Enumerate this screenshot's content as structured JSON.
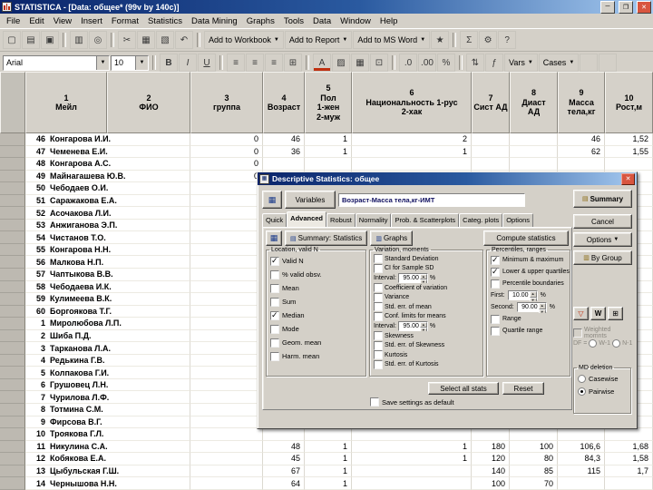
{
  "titlebar": {
    "title": "STATISTICA - [Data: общее* (99v by 140c)]"
  },
  "menu": {
    "items": [
      "File",
      "Edit",
      "View",
      "Insert",
      "Format",
      "Statistics",
      "Data Mining",
      "Graphs",
      "Tools",
      "Data",
      "Window",
      "Help"
    ]
  },
  "toolbar1": {
    "items": [
      {
        "type": "icon",
        "name": "new-file-icon",
        "glyph": "▢"
      },
      {
        "type": "icon",
        "name": "open-file-icon",
        "glyph": "▤"
      },
      {
        "type": "icon",
        "name": "save-icon",
        "glyph": "▣"
      },
      {
        "type": "sep"
      },
      {
        "type": "icon",
        "name": "print-icon",
        "glyph": "▥"
      },
      {
        "type": "icon",
        "name": "print-preview-icon",
        "glyph": "◎"
      },
      {
        "type": "sep"
      },
      {
        "type": "icon",
        "name": "cut-icon",
        "glyph": "✂"
      },
      {
        "type": "icon",
        "name": "copy-icon",
        "glyph": "▦"
      },
      {
        "type": "icon",
        "name": "paste-icon",
        "glyph": "▧"
      },
      {
        "type": "icon",
        "name": "undo-icon",
        "glyph": "↶"
      },
      {
        "type": "sep"
      },
      {
        "type": "dropbtn",
        "name": "add-to-workbook-button",
        "label": "Add to Workbook"
      },
      {
        "type": "dropbtn",
        "name": "add-to-report-button",
        "label": "Add to Report"
      },
      {
        "type": "dropbtn",
        "name": "add-to-ms-word-button",
        "label": "Add to MS Word"
      },
      {
        "type": "icon",
        "name": "wizard-icon",
        "glyph": "★"
      },
      {
        "type": "sep"
      },
      {
        "type": "icon",
        "name": "sum-icon",
        "glyph": "Σ"
      },
      {
        "type": "icon",
        "name": "settings-icon",
        "glyph": "⚙"
      },
      {
        "type": "icon",
        "name": "help-icon",
        "glyph": "?"
      }
    ]
  },
  "toolbar2": {
    "items": [
      {
        "type": "combo",
        "name": "font-family-combo",
        "value": "Arial",
        "w": 118
      },
      {
        "type": "combo",
        "name": "font-size-combo",
        "value": "10",
        "w": 42
      },
      {
        "type": "sep"
      },
      {
        "type": "icon",
        "name": "bold-icon",
        "glyph": "B",
        "cls": "b"
      },
      {
        "type": "icon",
        "name": "italic-icon",
        "glyph": "I",
        "cls": "i"
      },
      {
        "type": "icon",
        "name": "underline-icon",
        "glyph": "U",
        "cls": "u"
      },
      {
        "type": "sep"
      },
      {
        "type": "icon",
        "name": "align-left-icon",
        "glyph": "≡"
      },
      {
        "type": "icon",
        "name": "align-center-icon",
        "glyph": "≡"
      },
      {
        "type": "icon",
        "name": "align-right-icon",
        "glyph": "≡"
      },
      {
        "type": "icon",
        "name": "merge-cells-icon",
        "glyph": "⊞"
      },
      {
        "type": "sep"
      },
      {
        "type": "icon",
        "name": "font-color-icon",
        "glyph": "A",
        "cls": "red-underline"
      },
      {
        "type": "icon",
        "name": "fill-color-icon",
        "glyph": "▨"
      },
      {
        "type": "icon",
        "name": "borders-icon",
        "glyph": "▦"
      },
      {
        "type": "icon",
        "name": "grid-icon",
        "glyph": "⊡"
      },
      {
        "type": "sep"
      },
      {
        "type": "icon",
        "name": "increase-decimals-icon",
        "glyph": ".0"
      },
      {
        "type": "icon",
        "name": "decrease-decimals-icon",
        "glyph": ".00"
      },
      {
        "type": "icon",
        "name": "percent-icon",
        "glyph": "%"
      },
      {
        "type": "sep"
      },
      {
        "type": "icon",
        "name": "sort-icon",
        "glyph": "⇅"
      },
      {
        "type": "icon",
        "name": "function-icon",
        "glyph": "ƒ"
      },
      {
        "type": "dropbtn",
        "name": "vars-button",
        "label": "Vars"
      },
      {
        "type": "dropbtn",
        "name": "cases-button",
        "label": "Cases"
      },
      {
        "type": "icon",
        "name": "blank-tool-icon-1",
        "glyph": ""
      },
      {
        "type": "icon",
        "name": "blank-tool-icon-2",
        "glyph": ""
      }
    ]
  },
  "sheet": {
    "headers": [
      {
        "num": "1",
        "label": "Мейл"
      },
      {
        "num": "2",
        "label": "ФИО"
      },
      {
        "num": "3",
        "label": "группа"
      },
      {
        "num": "4",
        "label": "Возраст"
      },
      {
        "num": "5",
        "label": "Пол\n1-жен\n2-муж"
      },
      {
        "num": "6",
        "label": "Национальность 1-рус\n2-хак"
      },
      {
        "num": "7",
        "label": "Сист АД"
      },
      {
        "num": "8",
        "label": "Диаст\nАД"
      },
      {
        "num": "9",
        "label": "Масса\nтела,кг"
      },
      {
        "num": "10",
        "label": "Рост,м"
      }
    ],
    "rows": [
      {
        "n": "46",
        "name": "Конгарова И.И.",
        "c": [
          "0",
          "46",
          "1",
          "2",
          "",
          "",
          "46",
          "1,52"
        ]
      },
      {
        "n": "47",
        "name": "Чеменева Е.И.",
        "c": [
          "0",
          "36",
          "1",
          "1",
          "",
          "",
          "62",
          "1,55"
        ]
      },
      {
        "n": "48",
        "name": "Конгарова А.С.",
        "c": [
          "0",
          "",
          "",
          "",
          "",
          "",
          "",
          ""
        ]
      },
      {
        "n": "49",
        "name": "Майнагашева Ю.В.",
        "c": [
          "0",
          "",
          "",
          "",
          "",
          "",
          "",
          ""
        ]
      },
      {
        "n": "50",
        "name": "Чебодаев О.И.",
        "c": [
          "",
          "",
          "",
          "",
          "",
          "",
          "",
          ""
        ]
      },
      {
        "n": "51",
        "name": "Саражакова Е.А.",
        "c": [
          "",
          "",
          "",
          "",
          "",
          "",
          "",
          ""
        ]
      },
      {
        "n": "52",
        "name": "Асочакова Л.И.",
        "c": [
          "",
          "",
          "",
          "",
          "",
          "",
          "",
          ""
        ]
      },
      {
        "n": "53",
        "name": "Анжиганова Э.П.",
        "c": [
          "",
          "",
          "",
          "",
          "",
          "",
          "",
          ""
        ]
      },
      {
        "n": "54",
        "name": "Чистанов Т.О.",
        "c": [
          "",
          "",
          "",
          "",
          "",
          "",
          "",
          ""
        ]
      },
      {
        "n": "55",
        "name": "Конгарова Н.Н.",
        "c": [
          "",
          "",
          "",
          "",
          "",
          "",
          "",
          ""
        ]
      },
      {
        "n": "56",
        "name": "Малкова Н.П.",
        "c": [
          "",
          "",
          "",
          "",
          "",
          "",
          "",
          ""
        ]
      },
      {
        "n": "57",
        "name": "Чаптыкова В.В.",
        "c": [
          "",
          "",
          "",
          "",
          "",
          "",
          "",
          ""
        ]
      },
      {
        "n": "58",
        "name": "Чебодаева И.К.",
        "c": [
          "",
          "",
          "",
          "",
          "",
          "",
          "",
          ""
        ]
      },
      {
        "n": "59",
        "name": "Кулимеева В.К.",
        "c": [
          "",
          "",
          "",
          "",
          "",
          "",
          "",
          ""
        ]
      },
      {
        "n": "60",
        "name": "Боргоякова Т.Г.",
        "c": [
          "",
          "",
          "",
          "",
          "",
          "",
          "",
          ""
        ]
      },
      {
        "n": "1",
        "name": "Миролюбова Л.П.",
        "c": [
          "",
          "",
          "",
          "",
          "",
          "",
          "",
          ""
        ]
      },
      {
        "n": "2",
        "name": "Шиба П.Д.",
        "c": [
          "",
          "",
          "",
          "",
          "",
          "",
          "",
          ""
        ]
      },
      {
        "n": "3",
        "name": "Тарканова Л.А.",
        "c": [
          "",
          "",
          "",
          "",
          "",
          "",
          "",
          ""
        ]
      },
      {
        "n": "4",
        "name": "Редькина Г.В.",
        "c": [
          "",
          "",
          "",
          "",
          "",
          "",
          "",
          ""
        ]
      },
      {
        "n": "5",
        "name": "Колпакова Г.И.",
        "c": [
          "",
          "",
          "",
          "",
          "",
          "",
          "",
          ""
        ]
      },
      {
        "n": "6",
        "name": "Грушовец Л.Н.",
        "c": [
          "",
          "",
          "",
          "",
          "",
          "",
          "",
          ""
        ]
      },
      {
        "n": "7",
        "name": "Чурилова Л.Ф.",
        "c": [
          "",
          "",
          "",
          "",
          "",
          "",
          "",
          ""
        ]
      },
      {
        "n": "8",
        "name": "Тотмина С.М.",
        "c": [
          "",
          "",
          "",
          "",
          "",
          "",
          "",
          ""
        ]
      },
      {
        "n": "9",
        "name": "Фирсова В.Г.",
        "c": [
          "",
          "",
          "",
          "",
          "",
          "",
          "",
          ""
        ]
      },
      {
        "n": "10",
        "name": "Троякова Г.Л.",
        "c": [
          "",
          "",
          "",
          "",
          "",
          "",
          "",
          ""
        ]
      },
      {
        "n": "11",
        "name": "Никулина С.А.",
        "c": [
          "",
          "48",
          "1",
          "1",
          "180",
          "100",
          "106,6",
          "1,68"
        ]
      },
      {
        "n": "12",
        "name": "Кобякова Е.А.",
        "c": [
          "",
          "45",
          "1",
          "1",
          "120",
          "80",
          "84,3",
          "1,58"
        ]
      },
      {
        "n": "13",
        "name": "Цыбульская Г.Ш.",
        "c": [
          "",
          "67",
          "1",
          "",
          "140",
          "85",
          "115",
          "1,7"
        ]
      },
      {
        "n": "14",
        "name": "Чернышова Н.Н.",
        "c": [
          "",
          "64",
          "1",
          "",
          "100",
          "70",
          "",
          ""
        ]
      }
    ]
  },
  "dialog": {
    "title": "Descriptive Statistics: общее",
    "variables_button": "Variables",
    "variables_value": "Возраст-Масса тела,кг-ИМТ",
    "summary_button": "Summary",
    "cancel_button": "Cancel",
    "options_button": "Options",
    "by_group_button": "By Group",
    "tabs": [
      "Quick",
      "Advanced",
      "Robust",
      "Normality",
      "Prob. & Scatterplots",
      "Categ. plots",
      "Options"
    ],
    "active_tab": "Advanced",
    "panel_buttons": {
      "summary_statistics": "Summary: Statistics",
      "graphs": "Graphs",
      "compute": "Compute statistics"
    },
    "groups": {
      "location": {
        "title": "Location, valid N",
        "items": [
          {
            "label": "Valid N",
            "checked": true
          },
          {
            "label": "% valid obsv."
          },
          {
            "label": "Mean"
          },
          {
            "label": "Sum"
          },
          {
            "label": "Median",
            "checked": true
          },
          {
            "label": "Mode"
          },
          {
            "label": "Geom. mean"
          },
          {
            "label": "Harm. mean"
          }
        ]
      },
      "variation": {
        "title": "Variation, moments",
        "items": [
          {
            "label": "Standard Deviation"
          },
          {
            "label": "CI for Sample SD"
          },
          {
            "type": "spin",
            "label": "Interval:",
            "value": "95.00",
            "suffix": "%"
          },
          {
            "label": "Coefficient of variation"
          },
          {
            "label": "Variance"
          },
          {
            "label": "Std. err. of mean"
          },
          {
            "label": "Conf. limits for means"
          },
          {
            "type": "spin",
            "label": "Interval:",
            "value": "95.00",
            "suffix": "%"
          },
          {
            "label": "Skewness"
          },
          {
            "label": "Std. err. of Skewness"
          },
          {
            "label": "Kurtosis"
          },
          {
            "label": "Std. err. of Kurtosis"
          }
        ]
      },
      "percentiles": {
        "title": "Percentiles, ranges",
        "items": [
          {
            "label": "Minimum & maximum",
            "checked": true
          },
          {
            "label": "Lower & upper quartiles",
            "checked": true
          },
          {
            "label": "Percentile boundaries"
          },
          {
            "type": "spin",
            "label": "First:",
            "value": "10.00",
            "suffix": "%"
          },
          {
            "type": "spin",
            "label": "Second:",
            "value": "90.00",
            "suffix": "%"
          },
          {
            "label": "Range"
          },
          {
            "label": "Quartile range"
          }
        ]
      }
    },
    "bottom": {
      "select_all": "Select all stats",
      "reset": "Reset",
      "save_default": "Save settings as default"
    },
    "right": {
      "weighted": "Weighted momnts",
      "df_label": "DF =",
      "df_options": [
        "W-1",
        "N-1"
      ],
      "md": {
        "title": "MD deletion",
        "options": [
          {
            "label": "Casewise",
            "selected": false
          },
          {
            "label": "Pairwise",
            "selected": true
          }
        ]
      }
    }
  }
}
